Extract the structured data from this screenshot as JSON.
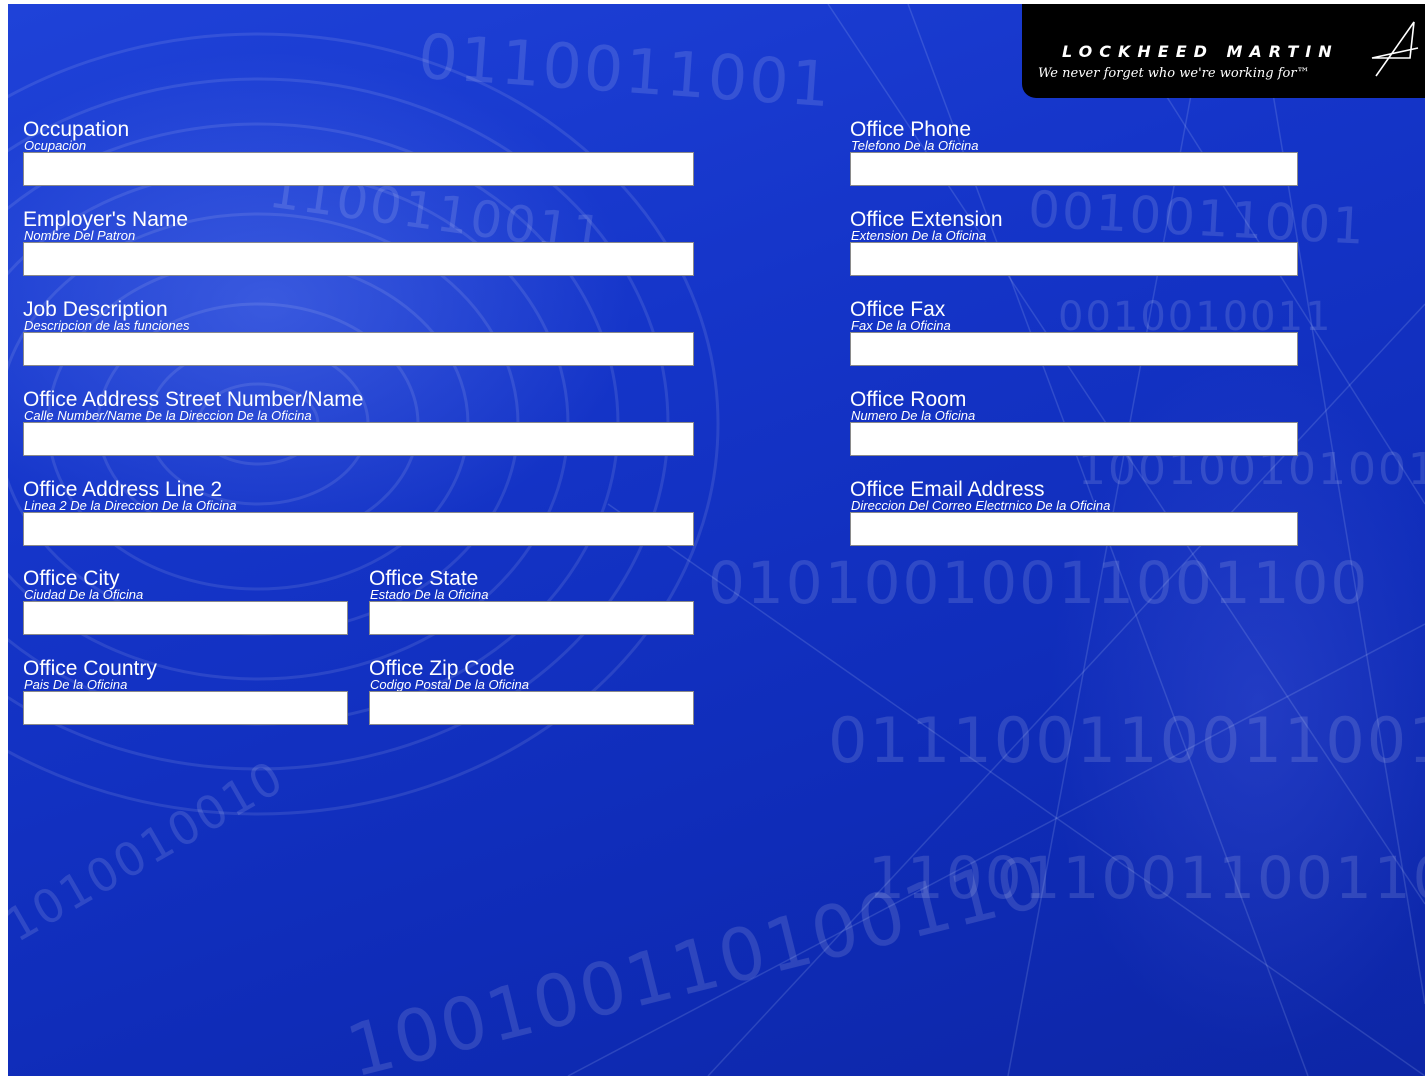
{
  "logo": {
    "name": "LOCKHEED MARTIN",
    "tagline": "We never forget who we're working for™"
  },
  "form": {
    "occupation": {
      "label": "Occupation",
      "sublabel": "Ocupacion",
      "value": ""
    },
    "employer_name": {
      "label": "Employer's Name",
      "sublabel": "Nombre Del Patron",
      "value": ""
    },
    "job_description": {
      "label": "Job Description",
      "sublabel": "Descripcion de las funciones",
      "value": ""
    },
    "office_street": {
      "label": "Office Address Street Number/Name",
      "sublabel": "Calle Number/Name De la Direccion De la Oficina",
      "value": ""
    },
    "office_line2": {
      "label": "Office Address Line 2",
      "sublabel": "Linea 2 De la Direccion De la Oficina",
      "value": ""
    },
    "office_city": {
      "label": "Office City",
      "sublabel": "Ciudad De la Oficina",
      "value": ""
    },
    "office_state": {
      "label": "Office State",
      "sublabel": "Estado De la Oficina",
      "value": ""
    },
    "office_country": {
      "label": "Office Country",
      "sublabel": "Pais De la Oficina",
      "value": ""
    },
    "office_zip": {
      "label": "Office Zip Code",
      "sublabel": "Codigo Postal De la Oficina",
      "value": ""
    },
    "office_phone": {
      "label": "Office Phone",
      "sublabel": "Telefono De la Oficina",
      "value": ""
    },
    "office_extension": {
      "label": "Office Extension",
      "sublabel": "Extension De la Oficina",
      "value": ""
    },
    "office_fax": {
      "label": "Office Fax",
      "sublabel": "Fax De la Oficina",
      "value": ""
    },
    "office_room": {
      "label": "Office Room",
      "sublabel": "Numero De la Oficina",
      "value": ""
    },
    "office_email": {
      "label": "Office Email Address",
      "sublabel": "Direccion Del Correo Electrnico De la Oficina",
      "value": ""
    }
  },
  "colors": {
    "background": "#1535c9",
    "logo_background": "#000000",
    "text": "#ffffff",
    "field_background": "#ffffff"
  }
}
